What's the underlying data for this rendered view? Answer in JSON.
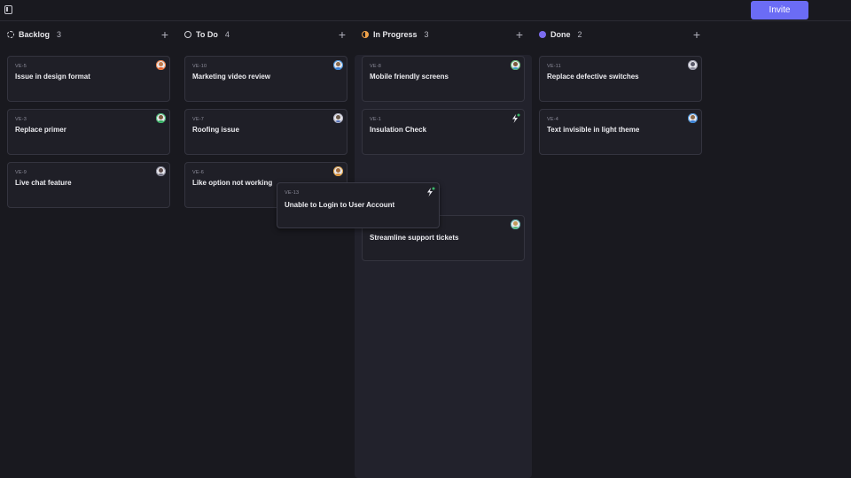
{
  "header": {
    "invite_label": "Invite"
  },
  "columns": [
    {
      "title": "Backlog",
      "count": "3"
    },
    {
      "title": "To Do",
      "count": "4"
    },
    {
      "title": "In Progress",
      "count": "3"
    },
    {
      "title": "Done",
      "count": "2"
    }
  ],
  "cards": {
    "backlog": [
      {
        "id": "VE-5",
        "title": "Issue in design format"
      },
      {
        "id": "VE-3",
        "title": "Replace primer"
      },
      {
        "id": "VE-9",
        "title": "Live chat feature"
      }
    ],
    "todo": [
      {
        "id": "VE-10",
        "title": "Marketing video review"
      },
      {
        "id": "VE-7",
        "title": "Roofing issue"
      },
      {
        "id": "VE-6",
        "title": "Like option not working"
      }
    ],
    "progress": [
      {
        "id": "VE-8",
        "title": "Mobile friendly screens"
      },
      {
        "id": "VE-1",
        "title": "Insulation Check"
      },
      {
        "id": "",
        "title": "Streamline support tickets"
      }
    ],
    "done": [
      {
        "id": "VE-11",
        "title": "Replace defective switches"
      },
      {
        "id": "VE-4",
        "title": "Text invisible in light theme"
      }
    ]
  },
  "dragging": {
    "id": "VE-13",
    "title": "Unable to Login to User Account"
  },
  "colors": {
    "accent": "#6b6cf5",
    "in_progress": "#f0a24a",
    "done": "#7c6cf0"
  }
}
